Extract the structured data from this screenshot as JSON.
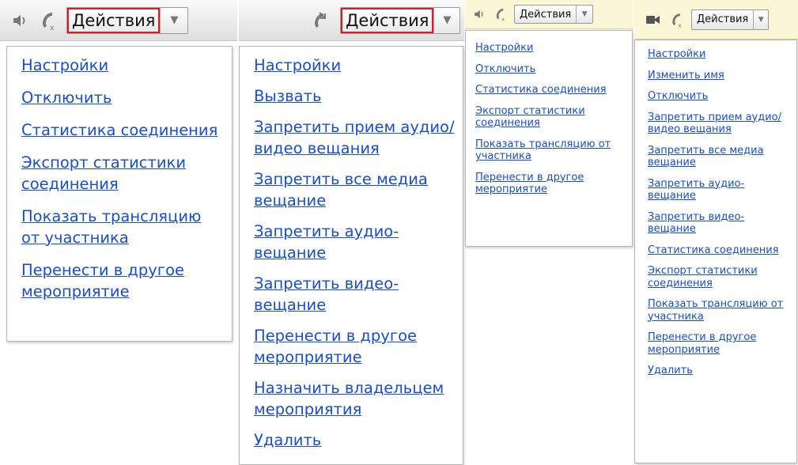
{
  "colors": {
    "link": "#1a4ec7",
    "highlight": "#d81e1e",
    "toolbar_gray": "#e4e4e4",
    "toolbar_yellow": "#fbf7d6"
  },
  "icons": {
    "panel1": [
      "speaker-icon",
      "phone-hangup-icon"
    ],
    "panel2": [
      "phone-incoming-icon"
    ],
    "panel3": [
      "speaker-icon",
      "phone-hangup-icon"
    ],
    "panel4": [
      "video-camera-icon",
      "phone-hangup-icon"
    ]
  },
  "panel1": {
    "actions_label": "Действия",
    "arrow": "▼",
    "items": [
      "Настройки",
      "Отключить",
      "Статистика соединения",
      "Экспорт статистики соединения",
      "Показать трансляцию от участника",
      "Перенести в другое мероприятие"
    ]
  },
  "panel2": {
    "actions_label": "Действия",
    "arrow": "▼",
    "items": [
      "Настройки",
      "Вызвать",
      "Запретить прием аудио/видео вещания",
      "Запретить все медиа вещание",
      "Запретить аудио-вещание",
      "Запретить видео-вещание",
      "Перенести в другое мероприятие",
      "Назначить владельцем мероприятия",
      "Удалить"
    ]
  },
  "panel3": {
    "actions_label": "Действия",
    "arrow": "▼",
    "items": [
      "Настройки",
      "Отключить",
      "Статистика соединения",
      "Экспорт статистики соединения",
      "Показать трансляцию от участника",
      "Перенести в другое мероприятие"
    ]
  },
  "panel4": {
    "actions_label": "Действия",
    "arrow": "▼",
    "items": [
      "Настройки",
      "Изменить имя",
      "Отключить",
      "Запретить прием аудио/видео вещания",
      "Запретить все медиа вещание",
      "Запретить аудио-вещание",
      "Запретить видео-вещание",
      "Статистика соединения",
      "Экспорт статистики соединения",
      "Показать трансляцию от участника",
      "Перенести в другое мероприятие",
      "Удалить"
    ]
  }
}
